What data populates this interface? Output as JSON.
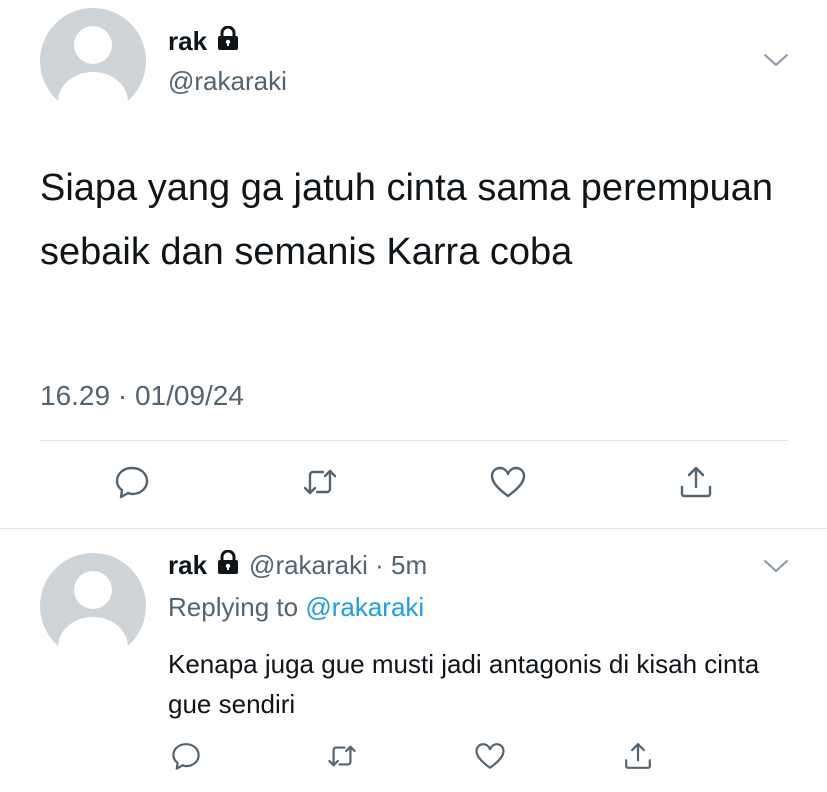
{
  "main_tweet": {
    "name": "rak",
    "handle": "@rakaraki",
    "text": "Siapa yang ga jatuh cinta sama perempuan sebaik dan semanis Karra coba",
    "timestamp": "16.29 · 01/09/24"
  },
  "reply_tweet": {
    "name": "rak",
    "meta": "@rakaraki · 5m",
    "replying_prefix": "Replying to",
    "replying_handle": "@rakaraki",
    "text": "Kenapa juga gue musti jadi antagonis di kisah cinta gue sendiri"
  },
  "icons": [
    "lock-icon",
    "chevron-down-icon",
    "reply-icon",
    "retweet-icon",
    "like-icon",
    "share-icon"
  ],
  "colors": {
    "text": "#0f1419",
    "secondary": "#536471",
    "link": "#1d9bf0",
    "icon": "#536471",
    "divider": "#e1e4e8",
    "avatar_bg": "#cfd4d9"
  }
}
